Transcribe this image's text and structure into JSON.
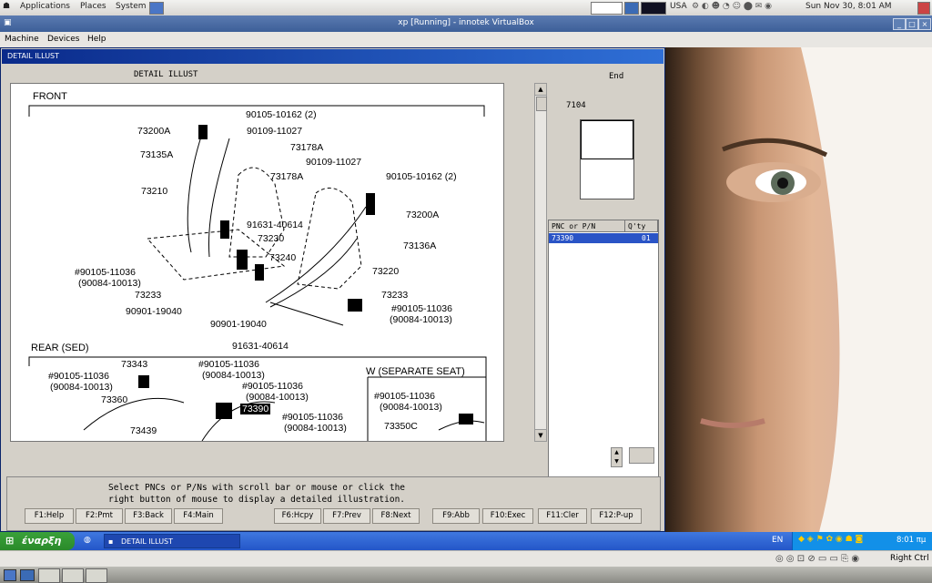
{
  "gnome_top": {
    "menus": [
      "Applications",
      "Places",
      "System"
    ],
    "locale": "USA",
    "clock": "Sun Nov 30,  8:01 AM"
  },
  "vbox": {
    "title": "xp [Running] - innotek VirtualBox",
    "menu": [
      "Machine",
      "Devices",
      "Help"
    ],
    "status_text": "Right Ctrl"
  },
  "detail_window": {
    "title": "DETAIL ILLUST",
    "illus_header": "DETAIL ILLUST",
    "end_label": "End",
    "thumb_label": "7104",
    "table_headers": [
      "PNC or P/N",
      "Q'ty"
    ],
    "table_rows": [
      {
        "pnc": "73390",
        "qty": "01"
      }
    ],
    "instruction_line1": "Select PNCs or P/Ns with scroll bar or mouse or click the",
    "instruction_line2": "right button of mouse to display a detailed illustration.",
    "fkeys": [
      "F1:Help",
      "F2:Pmt",
      "F3:Back",
      "F4:Main",
      "F6:Hcpy",
      "F7:Prev",
      "F8:Next",
      "F9:Abb",
      "F10:Exec",
      "F11:Cler",
      "F12:P-up"
    ]
  },
  "illustration": {
    "front_label": "FRONT",
    "rear_label": "REAR (SED)",
    "separate_label": "W (SEPARATE SEAT)",
    "highlight": "73390",
    "callouts_front": [
      "90105-10162 (2)",
      "73200A",
      "90109-11027",
      "73135A",
      "73178A",
      "73178A",
      "90109-11027",
      "90105-10162 (2)",
      "73210",
      "73200A",
      "91631-40614",
      "73230",
      "73136A",
      "73240",
      "#90105-11036",
      "(90084-10013)",
      "73220",
      "73233",
      "73233",
      "#90105-11036",
      "(90084-10013)",
      "90901-19040",
      "90901-19040",
      "91631-40614"
    ],
    "callouts_rear": [
      "73343",
      "#90105-11036",
      "(90084-10013)",
      "#90105-11036",
      "(90084-10013)",
      "73360",
      "#90105-11036",
      "(90084-10013)",
      "#90105-11036",
      "(90084-10013)",
      "73439",
      "#90105-11036",
      "(90084-10013)",
      "#90105-11036",
      "(90084-10013)",
      "73350C"
    ]
  },
  "xp_taskbar": {
    "start_label": "έναρξη",
    "task_label": "DETAIL ILLUST",
    "lang": "EN",
    "time": "8:01 πμ"
  }
}
